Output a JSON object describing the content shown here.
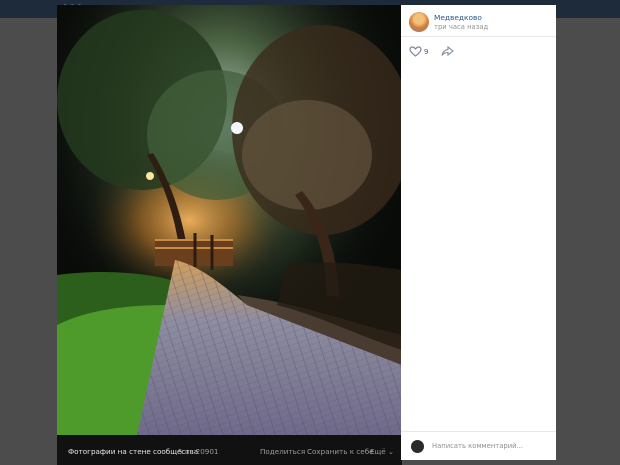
{
  "post": {
    "group_name": "Медведково",
    "time": "три часа назад",
    "likes": "9",
    "comment_placeholder": "Написать комментарий..."
  },
  "photo_bar": {
    "title": "Фотографии на стене сообщества",
    "counter": "5 из 20901",
    "share": "Поделиться",
    "save": "Сохранить к себе",
    "more": "Ещё ⌄"
  },
  "icons": [
    "heart-icon",
    "share-arrow-icon"
  ],
  "colors": {
    "link": "#2a5885",
    "meta": "#939393",
    "overlay": "#4c4c4c"
  }
}
